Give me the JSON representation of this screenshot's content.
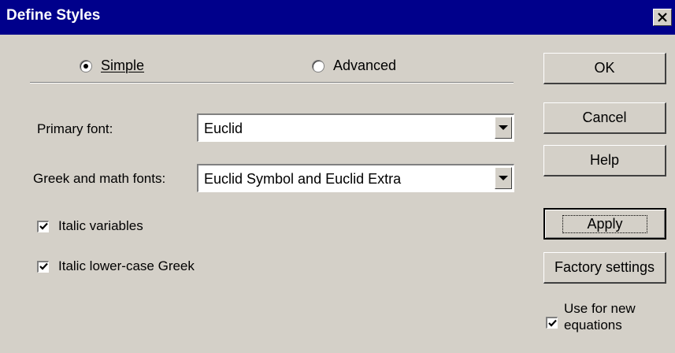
{
  "window": {
    "title": "Define Styles",
    "close_icon": "close-icon"
  },
  "mode": {
    "simple": {
      "label": "Simple",
      "selected": true
    },
    "advanced": {
      "label": "Advanced",
      "selected": false
    }
  },
  "primary_font": {
    "label": "Primary font:",
    "value": "Euclid"
  },
  "greek_math_fonts": {
    "label": "Greek and math fonts:",
    "value": "Euclid Symbol and Euclid Extra"
  },
  "options": {
    "italic_variables": {
      "label": "Italic variables",
      "checked": true
    },
    "italic_lower_greek": {
      "label": "Italic lower-case Greek",
      "checked": true
    }
  },
  "buttons": {
    "ok": "OK",
    "cancel": "Cancel",
    "help": "Help",
    "apply": "Apply",
    "factory": "Factory settings"
  },
  "use_for_new": {
    "line1": "Use for new",
    "line2": "equations",
    "checked": true
  },
  "colors": {
    "titlebar": "#00008b",
    "face": "#d4d0c8"
  }
}
